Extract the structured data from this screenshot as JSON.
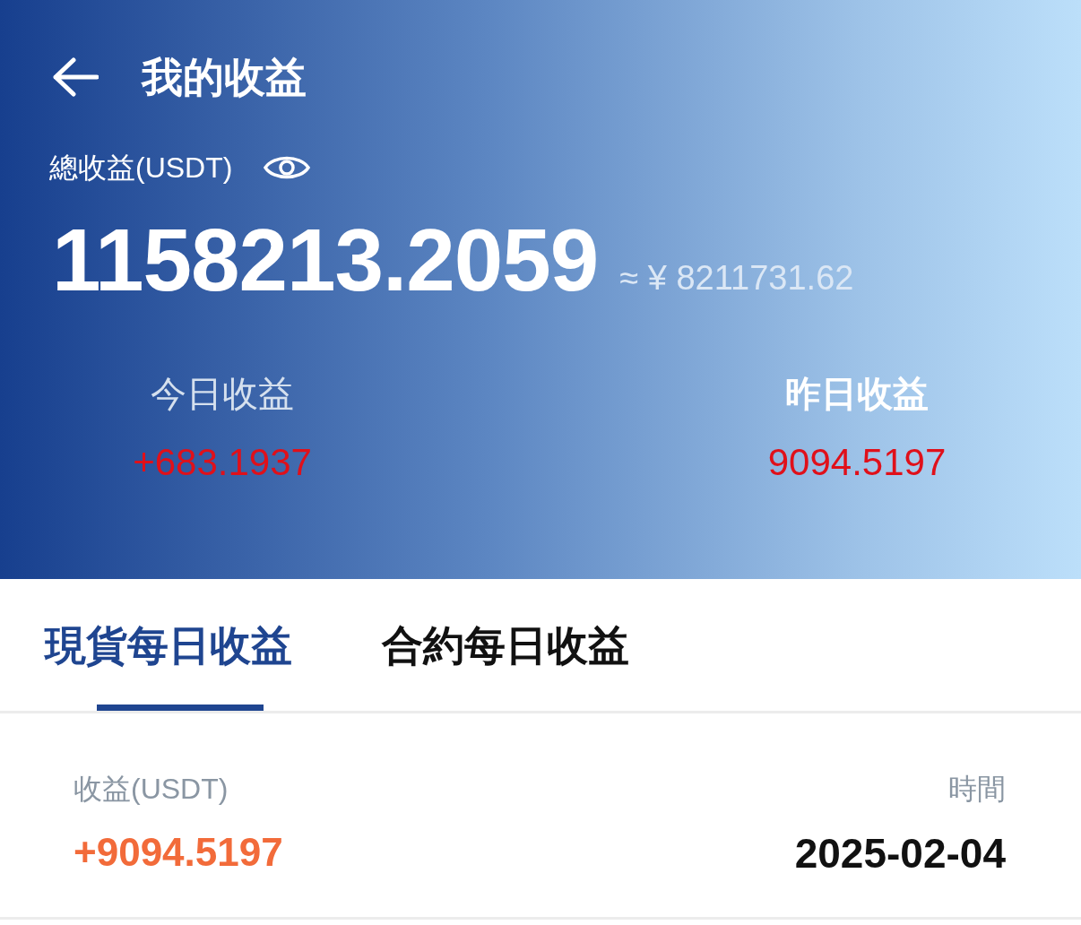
{
  "header": {
    "title": "我的收益"
  },
  "total": {
    "label": "總收益(USDT)",
    "amount": "1158213.2059",
    "approx": "≈ ¥ 8211731.62"
  },
  "stats": [
    {
      "label": "今日收益",
      "value": "+683.1937",
      "selected": false
    },
    {
      "label": "昨日收益",
      "value": "9094.5197",
      "selected": true
    }
  ],
  "tabs": [
    {
      "label": "現貨每日收益",
      "selected": true
    },
    {
      "label": "合約每日收益",
      "selected": false
    }
  ],
  "table": {
    "columns": [
      "收益(USDT)",
      "時間"
    ],
    "rows": [
      [
        "+9094.5197",
        "2025-02-04"
      ]
    ]
  }
}
